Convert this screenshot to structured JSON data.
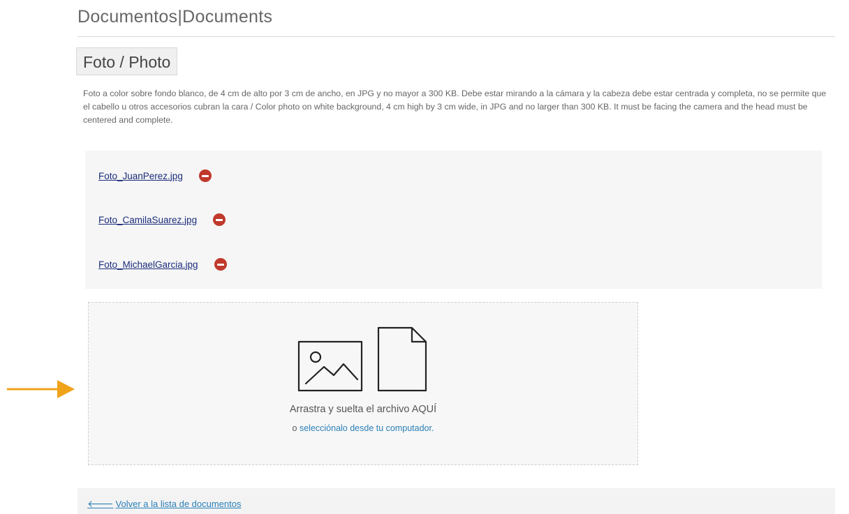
{
  "page": {
    "title": "Documentos|Documents"
  },
  "section": {
    "label": "Foto / Photo",
    "description": "Foto a color sobre fondo blanco, de 4 cm de alto por 3 cm de ancho, en JPG y no mayor a 300 KB. Debe estar mirando a la cámara y la cabeza debe estar centrada y completa, no se permite que el cabello u otros accesorios cubran la cara / Color photo on white background, 4 cm high by 3 cm wide, in JPG and no larger than 300 KB. It must be facing the camera and the head must be centered and complete."
  },
  "files": [
    {
      "name": "Foto_JuanPerez.jpg"
    },
    {
      "name": "Foto_CamilaSuarez.jpg"
    },
    {
      "name": "Foto_MichaelGarcia.jpg"
    }
  ],
  "dropzone": {
    "main_text": "Arrastra y suelta el archivo AQUÍ",
    "sub_prefix": "o",
    "sub_link": "selecciónalo desde tu computador."
  },
  "footer": {
    "back_label": "Volver a la lista de documentos"
  },
  "icons": {
    "remove": "minus-circle-icon",
    "image": "image-icon",
    "file": "file-icon",
    "back": "arrow-left-icon",
    "pointer": "arrow-right-icon"
  },
  "colors": {
    "remove": "#c0392b",
    "link": "#2a7fb8",
    "file_link": "#1a2c7a",
    "arrow": "#f0a21a"
  }
}
